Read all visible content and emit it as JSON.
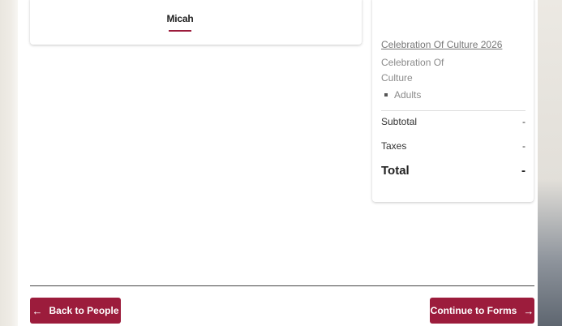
{
  "person_card": {
    "name": "Micah"
  },
  "order_summary": {
    "event_link": "Celebration Of Culture 2026",
    "event_name": "Celebration Of Culture",
    "items": [
      "Adults"
    ],
    "subtotal_label": "Subtotal",
    "subtotal_value": "-",
    "taxes_label": "Taxes",
    "taxes_value": "-",
    "total_label": "Total",
    "total_value": "-"
  },
  "footer": {
    "back_label": "Back to People",
    "continue_label": "Continue to Forms"
  },
  "icons": {
    "back": "arrow-left-icon",
    "continue": "arrow-right-icon"
  },
  "colors": {
    "accent": "#9c1c3c"
  }
}
